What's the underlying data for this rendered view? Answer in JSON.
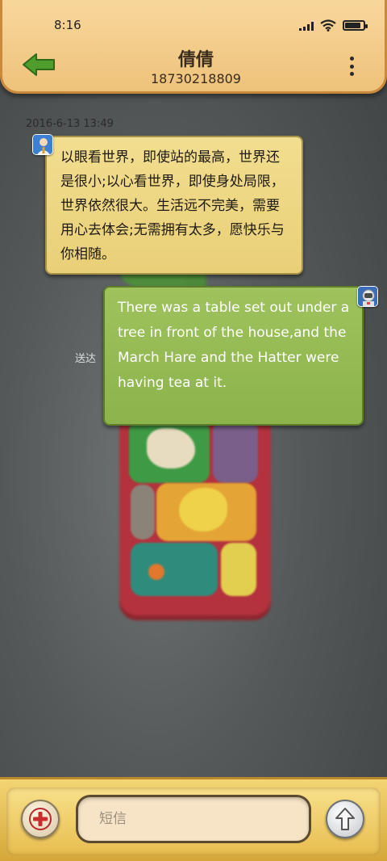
{
  "status_bar": {
    "time": "8:16",
    "icons": [
      "signal-icon",
      "wifi-icon",
      "battery-icon"
    ]
  },
  "header": {
    "contact_name": "倩倩",
    "contact_number": "18730218809",
    "back_icon": "arrow-left-icon",
    "menu_icon": "more-vertical-icon"
  },
  "conversation": {
    "timestamp": "2016-6-13 13:49",
    "incoming": {
      "text": "以眼看世界，即使站的最高，世界还是很小;以心看世界，即使身处局限，世界依然很大。生活远不完美，需要用心去体会;无需拥有太多，愿快乐与你相随。"
    },
    "outgoing": {
      "text": "There was a table set out under a tree in front of the house,and the March Hare and the Hatter were having tea at it.",
      "status": "送达"
    }
  },
  "composer": {
    "placeholder": "短信",
    "add_icon": "plus-icon",
    "send_icon": "arrow-up-icon"
  },
  "colors": {
    "header": "#eec27a",
    "incoming_bubble": "#ecd47e",
    "outgoing_bubble": "#94b953",
    "bottom_bar": "#e6bd4f"
  }
}
